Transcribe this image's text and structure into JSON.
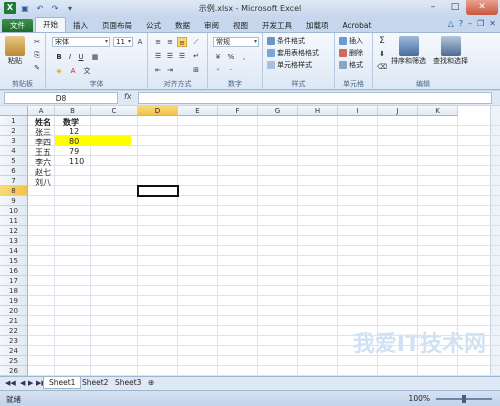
{
  "window": {
    "title": "示例.xlsx - Microsoft Excel",
    "app_icon": "X",
    "qat_icons": [
      "save-icon",
      "undo-icon",
      "redo-icon",
      "customize-icon"
    ]
  },
  "tabs": [
    "文件",
    "开始",
    "插入",
    "页面布局",
    "公式",
    "数据",
    "审阅",
    "视图",
    "开发工具",
    "加载项",
    "Acrobat"
  ],
  "ribbon": {
    "clipboard": {
      "label": "剪贴板",
      "paste": "粘贴"
    },
    "font": {
      "label": "字体",
      "name": "宋体",
      "size": "11"
    },
    "alignment": {
      "label": "对齐方式"
    },
    "number": {
      "label": "数字",
      "format": "常规"
    },
    "styles": {
      "label": "样式",
      "conditional": "条件格式",
      "table": "套用表格格式",
      "cell_styles": "单元格样式"
    },
    "cells": {
      "label": "单元格",
      "insert": "插入",
      "delete": "删除",
      "format": "格式"
    },
    "editing": {
      "label": "编辑",
      "sort": "排序和筛选",
      "find": "查找和选择",
      "sigma": "Σ"
    }
  },
  "formula_bar": {
    "name_box": "D8",
    "fx": "fx",
    "value": ""
  },
  "grid": {
    "columns": [
      "A",
      "B",
      "C",
      "D",
      "E",
      "F",
      "G",
      "H",
      "I",
      "J",
      "K"
    ],
    "rows": [
      "1",
      "2",
      "3",
      "4",
      "5",
      "6",
      "7",
      "8",
      "9",
      "10",
      "11",
      "12",
      "13",
      "14",
      "15",
      "16",
      "17",
      "18",
      "19",
      "20",
      "21",
      "22",
      "23",
      "24",
      "25",
      "26"
    ],
    "selected_column": "D",
    "selected_row": "8",
    "data": [
      {
        "a": "姓名",
        "b": "数学"
      },
      {
        "a": "张三",
        "b": "12"
      },
      {
        "a": "李四",
        "b": "80"
      },
      {
        "a": "王五",
        "b": "79"
      },
      {
        "a": "李六",
        "b": "110"
      },
      {
        "a": "赵七",
        "b": ""
      },
      {
        "a": "刘八",
        "b": ""
      }
    ],
    "highlight_color": "#ffff00"
  },
  "sheets": [
    "Sheet1",
    "Sheet2",
    "Sheet3"
  ],
  "active_sheet": "Sheet1",
  "status": {
    "ready": "就绪",
    "zoom": "100%"
  },
  "watermark": "我爱IT技术网"
}
